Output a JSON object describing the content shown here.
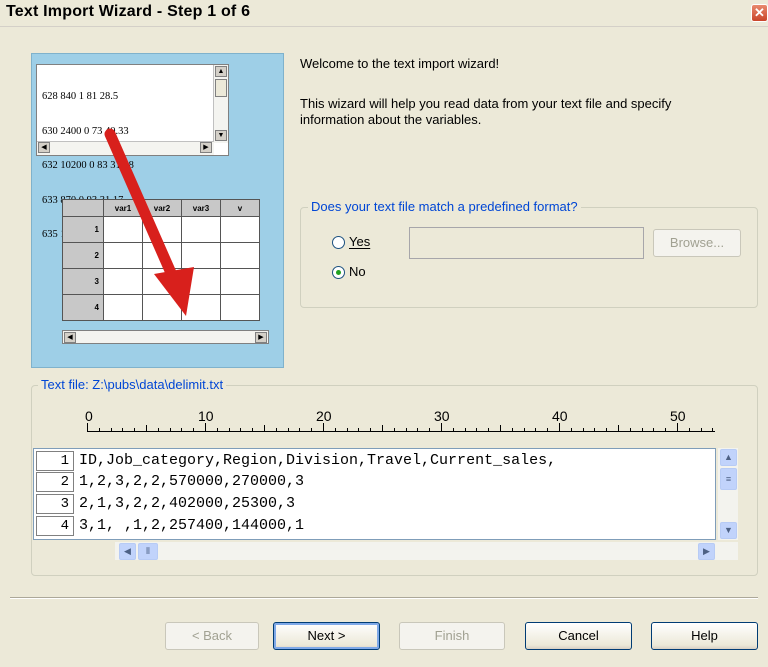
{
  "window": {
    "title": "Text Import Wizard - Step 1 of 6",
    "close_glyph": "✕"
  },
  "illustration": {
    "text_lines": [
      "628 840 1 81 28.5",
      "630 2400 0 73 40.33",
      "632 10200 0 83 31.08",
      "633 870 0 93 31.17",
      "635 1740 0 83 41.91"
    ],
    "columns": [
      "var1",
      "var2",
      "var3",
      "v"
    ],
    "rows": [
      "1",
      "2",
      "3",
      "4"
    ]
  },
  "welcome": {
    "heading": "Welcome to the text import wizard!",
    "description": "This wizard will help you read data from your text file and specify information about the variables."
  },
  "format_group": {
    "legend": "Does your text file match a predefined format?",
    "yes_label": "Yes",
    "no_label": "No",
    "selected": "No",
    "path_value": "",
    "browse_label": "Browse..."
  },
  "text_file": {
    "legend": "Text file: Z:\\pubs\\data\\delimit.txt",
    "ruler_labels": [
      "0",
      "10",
      "20",
      "30",
      "40",
      "50"
    ],
    "rows": [
      {
        "num": "1",
        "text": "ID,Job_category,Region,Division,Travel,Current_sales,"
      },
      {
        "num": "2",
        "text": "1,2,3,2,2,570000,270000,3"
      },
      {
        "num": "3",
        "text": "2,1,3,2,2,402000,25300,3"
      },
      {
        "num": "4",
        "text": "3,1, ,1,2,257400,144000,1"
      }
    ]
  },
  "buttons": {
    "back": "< Back",
    "next": "Next >",
    "finish": "Finish",
    "cancel": "Cancel",
    "help": "Help"
  },
  "colors": {
    "accent": "#0046d5",
    "illustration_bg": "#9ecfe7",
    "arrow": "#d8201c"
  }
}
